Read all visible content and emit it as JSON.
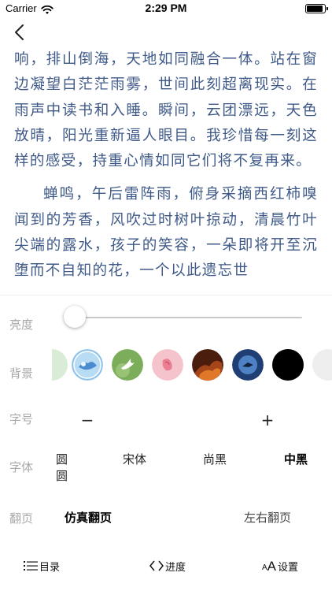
{
  "status_bar": {
    "carrier": "Carrier",
    "time": "2:29 PM"
  },
  "content": {
    "paragraph_1": "响，排山倒海，天地如同融合一体。站在窗边凝望白茫茫雨雾，世间此刻超离现实。在雨声中读书和入睡。瞬间，云团漂远，天色放晴，阳光重新逼人眼目。我珍惜每一刻这样的感受，持重心情如同它们将不复再来。",
    "paragraph_2": "蝉鸣，午后雷阵雨，俯身采摘西红柿嗅闻到的芳香，风吹过时树叶掠动，清晨竹叶尖端的露水，孩子的笑容，一朵即将开至沉堕而不自知的花，一个以此遗忘世",
    "text_color": "#3f5a88"
  },
  "settings": {
    "brightness_label": "亮度",
    "brightness_value": 0.0,
    "background_label": "背景",
    "backgrounds": [
      "pale-green",
      "blue-sky",
      "green-bird",
      "pink-flower",
      "dark-fire",
      "blue-night",
      "black",
      "light-gray"
    ],
    "font_size_label": "字号",
    "decrease_label": "−",
    "increase_label": "+",
    "font_label": "字体",
    "fonts": [
      "圆圆",
      "宋体",
      "尚黑",
      "中黑"
    ],
    "selected_font": "中黑",
    "page_turn_label": "翻页",
    "page_turn_options": [
      "仿真翻页",
      "左右翻页"
    ],
    "selected_page_turn": "仿真翻页"
  },
  "toolbar": {
    "catalog_label": "目录",
    "progress_label": "进度",
    "settings_label": "设置",
    "settings_icon_text": "A"
  }
}
